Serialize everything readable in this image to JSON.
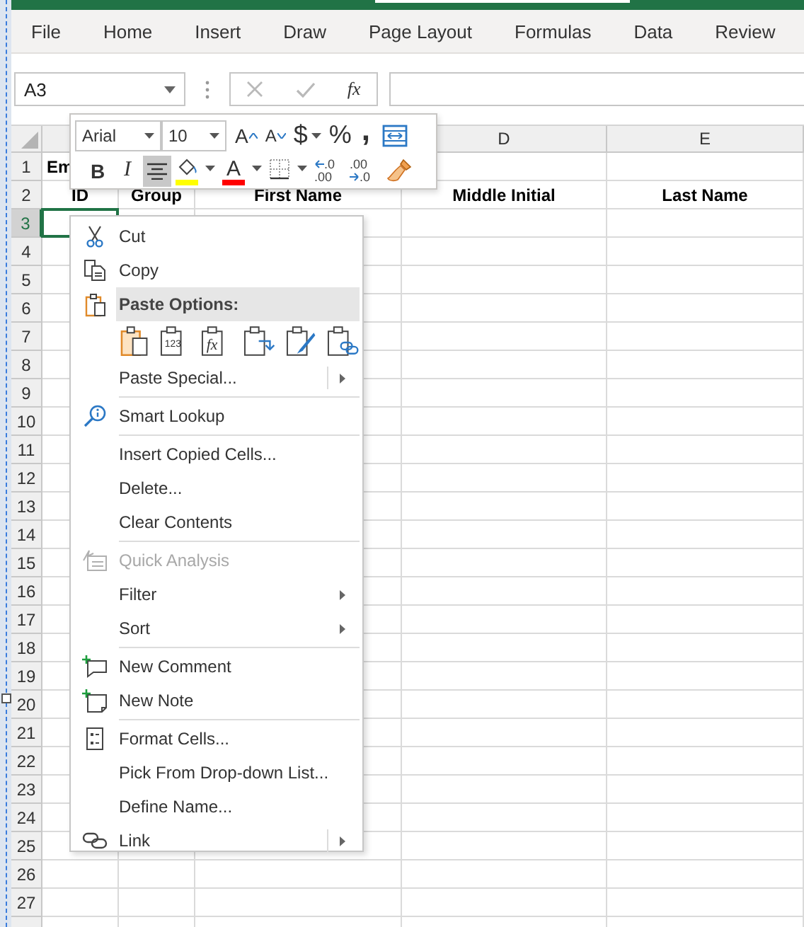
{
  "ribbon_tabs": [
    {
      "label": "File"
    },
    {
      "label": "Home"
    },
    {
      "label": "Insert"
    },
    {
      "label": "Draw"
    },
    {
      "label": "Page Layout"
    },
    {
      "label": "Formulas"
    },
    {
      "label": "Data"
    },
    {
      "label": "Review"
    }
  ],
  "name_box": {
    "value": "A3"
  },
  "formula_bar": {
    "function_button": "fx"
  },
  "sheet": {
    "columns": [
      {},
      {},
      {},
      {
        "label": "D"
      },
      {
        "label": "E"
      }
    ],
    "rows": [
      {
        "number": "1",
        "selected": false,
        "kind": "title",
        "cells": [
          "Em"
        ]
      },
      {
        "number": "2",
        "selected": false,
        "kind": "header",
        "cells": [
          "ID",
          "Group",
          "First Name",
          "Middle Initial",
          "Last Name"
        ]
      },
      {
        "number": "3",
        "selected": true
      },
      {
        "number": "4",
        "selected": false
      },
      {
        "number": "5",
        "selected": false
      },
      {
        "number": "6",
        "selected": false
      },
      {
        "number": "7",
        "selected": false
      },
      {
        "number": "8",
        "selected": false
      },
      {
        "number": "9",
        "selected": false
      },
      {
        "number": "10",
        "selected": false
      },
      {
        "number": "11",
        "selected": false
      },
      {
        "number": "12",
        "selected": false
      },
      {
        "number": "13",
        "selected": false
      },
      {
        "number": "14",
        "selected": false
      },
      {
        "number": "15",
        "selected": false
      },
      {
        "number": "16",
        "selected": false
      },
      {
        "number": "17",
        "selected": false
      },
      {
        "number": "18",
        "selected": false
      },
      {
        "number": "19",
        "selected": false
      },
      {
        "number": "20",
        "selected": false
      },
      {
        "number": "21",
        "selected": false
      },
      {
        "number": "22",
        "selected": false
      },
      {
        "number": "23",
        "selected": false
      },
      {
        "number": "24",
        "selected": false
      },
      {
        "number": "25",
        "selected": false
      },
      {
        "number": "26",
        "selected": false
      },
      {
        "number": "27",
        "selected": false
      }
    ]
  },
  "mini_toolbar": {
    "font": "Arial",
    "size": "10",
    "top": [
      {
        "kind": "grow",
        "text": "A"
      },
      {
        "kind": "shrink",
        "text": "A"
      },
      {
        "kind": "currency",
        "text": "$",
        "dropdown": true
      },
      {
        "kind": "percent",
        "text": "%"
      },
      {
        "kind": "comma",
        "text": ","
      },
      {
        "kind": "merge"
      }
    ],
    "bottom": [
      {
        "kind": "bold",
        "text": "B",
        "selected": false
      },
      {
        "kind": "italic",
        "text": "I",
        "selected": false
      },
      {
        "kind": "center",
        "selected": true
      },
      {
        "kind": "fill",
        "color": "#ffff00",
        "dropdown": true
      },
      {
        "kind": "fontcolor",
        "text": "A",
        "color": "#ff0000",
        "dropdown": true
      },
      {
        "kind": "borders",
        "dropdown": true
      },
      {
        "kind": "decimal-up",
        "text": ".0",
        "text2": ".00"
      },
      {
        "kind": "decimal-down",
        "text": ".00",
        "text2": ".0"
      },
      {
        "kind": "painter"
      }
    ]
  },
  "context_menu": {
    "groups": [
      {
        "items": [
          {
            "kind": "item",
            "label": "Cut"
          },
          {
            "kind": "item",
            "label": "Copy"
          },
          {
            "kind": "header",
            "label": "Paste Options:"
          },
          {
            "kind": "paste-icons",
            "icons": [
              {
                "kind": "paste"
              },
              {
                "kind": "values",
                "text": "123"
              },
              {
                "kind": "formulas",
                "text": "fx"
              },
              {
                "kind": "transpose"
              },
              {
                "kind": "formatting"
              },
              {
                "kind": "link"
              }
            ]
          },
          {
            "kind": "item",
            "label": "Paste Special...",
            "submenu": true
          }
        ]
      },
      {
        "items": [
          {
            "kind": "item",
            "label": "Smart Lookup"
          }
        ]
      },
      {
        "items": [
          {
            "kind": "item",
            "label": "Insert Copied Cells..."
          },
          {
            "kind": "item",
            "label": "Delete..."
          },
          {
            "kind": "item",
            "label": "Clear Contents"
          }
        ]
      },
      {
        "items": [
          {
            "kind": "item",
            "label": "Quick Analysis",
            "disabled": true
          },
          {
            "kind": "item",
            "label": "Filter",
            "submenu": true
          },
          {
            "kind": "item",
            "label": "Sort",
            "submenu": true
          }
        ]
      },
      {
        "items": [
          {
            "kind": "item",
            "label": "New Comment"
          },
          {
            "kind": "item",
            "label": "New Note"
          }
        ]
      },
      {
        "items": [
          {
            "kind": "item",
            "label": "Format Cells..."
          },
          {
            "kind": "item",
            "label": "Pick From Drop-down List..."
          },
          {
            "kind": "item",
            "label": "Define Name..."
          },
          {
            "kind": "item",
            "label": "Link",
            "submenu": true
          }
        ]
      }
    ]
  }
}
